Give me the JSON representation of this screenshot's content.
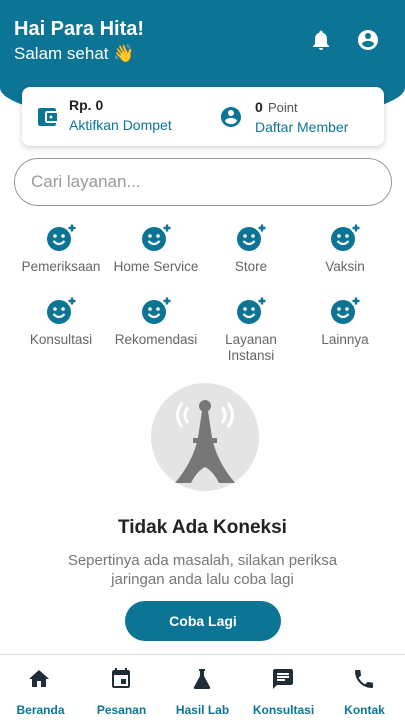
{
  "colors": {
    "primary": "#0c7596",
    "background": "#ffffff"
  },
  "header": {
    "greeting": "Hai Para Hita!",
    "subtitle": "Salam sehat 👋",
    "icons": [
      "bell-icon",
      "account-circle-icon"
    ]
  },
  "wallet": {
    "amount": "Rp. 0",
    "activate_label": "Aktifkan Dompet",
    "points_value": "0",
    "points_label": "Point",
    "member_label": "Daftar Member",
    "icons": [
      "wallet-icon",
      "account-circle-icon"
    ]
  },
  "search": {
    "placeholder": "Cari layanan..."
  },
  "services": [
    {
      "label": "Pemeriksaan",
      "icon": "face-plus-icon"
    },
    {
      "label": "Home Service",
      "icon": "face-plus-icon"
    },
    {
      "label": "Store",
      "icon": "face-plus-icon"
    },
    {
      "label": "Vaksin",
      "icon": "face-plus-icon"
    },
    {
      "label": "Konsultasi",
      "icon": "face-plus-icon"
    },
    {
      "label": "Rekomendasi",
      "icon": "face-plus-icon"
    },
    {
      "label": "Layanan Instansi",
      "icon": "face-plus-icon"
    },
    {
      "label": "Lainnya",
      "icon": "face-plus-icon"
    }
  ],
  "empty_state": {
    "icon": "radio-tower-icon",
    "title": "Tidak Ada Koneksi",
    "message": "Sepertinya ada masalah, silakan periksa jaringan anda lalu coba lagi",
    "retry_label": "Coba Lagi"
  },
  "bottom_nav": [
    {
      "label": "Beranda",
      "icon": "home-icon"
    },
    {
      "label": "Pesanan",
      "icon": "calendar-icon"
    },
    {
      "label": "Hasil Lab",
      "icon": "flask-icon"
    },
    {
      "label": "Konsultasi",
      "icon": "chat-icon"
    },
    {
      "label": "Kontak",
      "icon": "phone-icon"
    }
  ]
}
